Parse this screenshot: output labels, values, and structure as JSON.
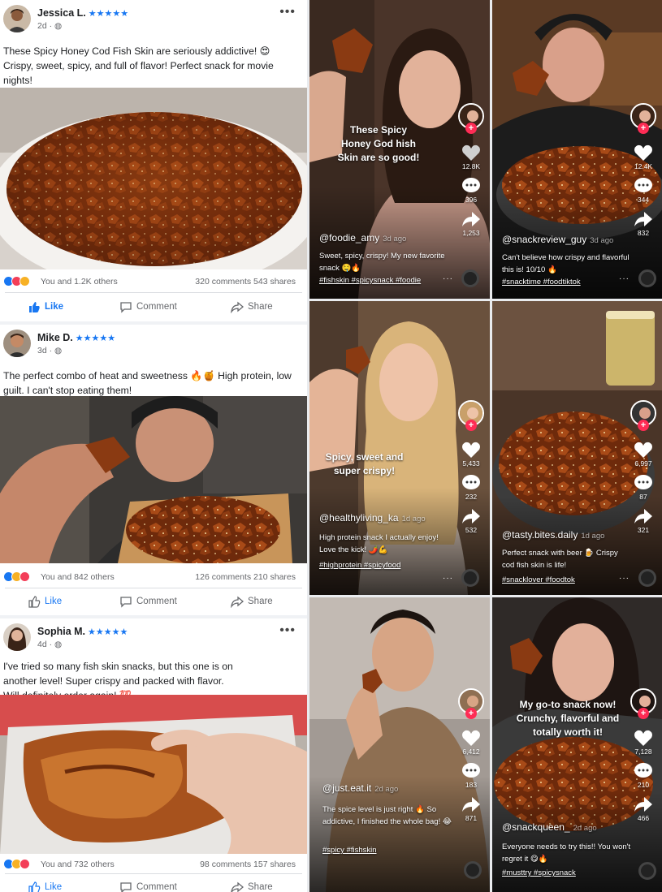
{
  "facebook": {
    "posts": [
      {
        "name": "Jessica L.",
        "stars": "★★★★★",
        "meta": "2d ·",
        "text": "These Spicy Honey Cod Fish Skin are seriously addictive! 😍 Crispy, sweet, spicy, and full of flavor! Perfect snack for movie nights!",
        "reactions_text": "You and 1.2K others",
        "counts": "320 comments  543 shares",
        "like": "Like",
        "comment": "Comment",
        "share": "Share"
      },
      {
        "name": "Mike D.",
        "stars": "★★★★★",
        "meta": "3d ·",
        "text": "The perfect combo of heat and sweetness 🔥🍯 High protein, low guilt. I can't stop eating them!",
        "reactions_text": "You and 842 others",
        "counts": "126 comments  210 shares",
        "like": "Like",
        "comment": "Comment",
        "share": "Share"
      },
      {
        "name": "Sophia M.",
        "stars": "★★★★★",
        "meta": "4d ·",
        "text": "I've tried so many fish skin snacks, but this one is on another level! Super crispy and packed with flavor. Will definitely order again! 💯",
        "reactions_text": "You and 732 others",
        "counts": "98 comments  157 shares",
        "like": "Like",
        "comment": "Comment",
        "share": "Share"
      }
    ]
  },
  "tiktok": [
    {
      "caption": "These Spicy Honey God hish Skin are so good!",
      "likes": "12.8K",
      "comments": "396",
      "shares": "1,253",
      "handle": "@foodie_amy",
      "ago": "3d ago",
      "desc": "Sweet, spicy, crispy! My new favorite snack 🤤🔥",
      "tags": "#fishskin #spicysnack #foodie"
    },
    {
      "caption": "",
      "likes": "12.4K",
      "comments": "344",
      "shares": "832",
      "handle": "@snackreview_guy",
      "ago": "3d ago",
      "desc": "Can't believe how crispy and flavorful this is! 10/10 🔥",
      "tags": "#snacktime #foodtiktok"
    },
    {
      "caption": "Spicy, sweet and super crispy!",
      "likes": "5,433",
      "comments": "232",
      "shares": "532",
      "handle": "@healthyliving_ka",
      "ago": "1d ago",
      "desc": "High protein snack I actually enjoy! Love the kick! 🌶️💪",
      "tags": "#highprotein #spicyfood"
    },
    {
      "caption": "",
      "likes": "6,997",
      "comments": "87",
      "shares": "321",
      "handle": "@tasty.bites.daily",
      "ago": "1d ago",
      "desc": "Perfect snack with beer 🍺 Crispy cod fish skin is life!",
      "tags": "#snacklover #foodtok"
    },
    {
      "caption": "",
      "likes": "6,412",
      "comments": "183",
      "shares": "871",
      "handle": "@just.eat.it",
      "ago": "2d ago",
      "desc": "The spice level is just right 🔥 So addictive, I finished the whole bag! 😂",
      "tags": "#spicy #fishskin"
    },
    {
      "caption": "My go-to snack now! Crunchy, flavorful and totally worth it!",
      "likes": "7,128",
      "comments": "210",
      "shares": "466",
      "handle": "@snackqueen_",
      "ago": "2d ago",
      "desc": "Everyone needs to try this!! You won't regret it 😋🔥",
      "tags": "#musttry #spicysnack"
    }
  ],
  "icons": [
    "heart-icon",
    "comment-icon",
    "share-arrow-icon",
    "more-icon",
    "like-thumb-icon",
    "globe-icon"
  ],
  "colors": {
    "facebook_blue": "#1877f2",
    "tiktok_red": "#fe2c55",
    "snack_glaze": "#8a3a12"
  }
}
